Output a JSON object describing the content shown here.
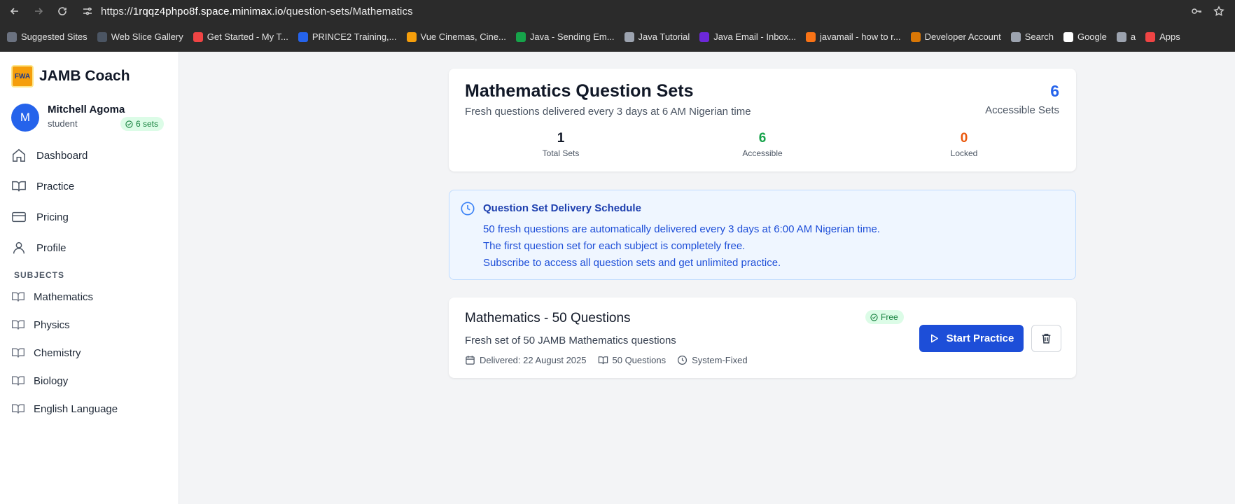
{
  "browser": {
    "url_prefix": "https://",
    "url_host": "1rqqz4phpo8f.space.minimax.io",
    "url_path": "/question-sets/Mathematics",
    "bookmarks": [
      {
        "label": "Suggested Sites",
        "icon": "suggested-icon",
        "color": "#6b7280"
      },
      {
        "label": "Web Slice Gallery",
        "icon": "web-slice-icon",
        "color": "#4b5563"
      },
      {
        "label": "Get Started - My T...",
        "icon": "location-pin-icon",
        "color": "#ef4444"
      },
      {
        "label": "PRINCE2 Training,...",
        "icon": "prince2-icon",
        "color": "#2563eb"
      },
      {
        "label": "Vue Cinemas, Cine...",
        "icon": "vue-icon",
        "color": "#f59e0b"
      },
      {
        "label": "Java - Sending Em...",
        "icon": "java-icon",
        "color": "#16a34a"
      },
      {
        "label": "Java Tutorial",
        "icon": "globe-icon",
        "color": "#9ca3af"
      },
      {
        "label": "Java Email - Inbox...",
        "icon": "yahoo-icon",
        "color": "#6d28d9"
      },
      {
        "label": "javamail - how to r...",
        "icon": "stackoverflow-icon",
        "color": "#f97316"
      },
      {
        "label": "Developer Account",
        "icon": "layers-icon",
        "color": "#d97706"
      },
      {
        "label": "Search",
        "icon": "search-icon",
        "color": "#9ca3af"
      },
      {
        "label": "Google",
        "icon": "google-icon",
        "color": "#ffffff"
      },
      {
        "label": "a",
        "icon": "globe-icon",
        "color": "#9ca3af"
      },
      {
        "label": "Apps",
        "icon": "apps-grid-icon",
        "color": "#ef4444"
      }
    ]
  },
  "sidebar": {
    "brand": "JAMB Coach",
    "logo_text": "FWA",
    "user": {
      "initial": "M",
      "name": "Mitchell Agoma",
      "role": "student",
      "sets": "6 sets"
    },
    "nav": [
      {
        "label": "Dashboard",
        "icon": "home-icon"
      },
      {
        "label": "Practice",
        "icon": "book-icon"
      },
      {
        "label": "Pricing",
        "icon": "credit-card-icon"
      },
      {
        "label": "Profile",
        "icon": "user-icon"
      }
    ],
    "subjects_heading": "SUBJECTS",
    "subjects": [
      "Mathematics",
      "Physics",
      "Chemistry",
      "Biology",
      "English Language"
    ]
  },
  "summary": {
    "title": "Mathematics Question Sets",
    "subtitle": "Fresh questions delivered every 3 days at 6 AM Nigerian time",
    "accessible_count": "6",
    "accessible_label": "Accessible Sets",
    "stats": [
      {
        "value": "1",
        "label": "Total Sets",
        "color": "#111827"
      },
      {
        "value": "6",
        "label": "Accessible",
        "color": "#16a34a"
      },
      {
        "value": "0",
        "label": "Locked",
        "color": "#ea580c"
      }
    ]
  },
  "schedule": {
    "title": "Question Set Delivery Schedule",
    "lines": [
      "50 fresh questions are automatically delivered every 3 days at 6:00 AM Nigerian time.",
      "The first question set for each subject is completely free.",
      "Subscribe to access all question sets and get unlimited practice."
    ]
  },
  "question_set": {
    "title": "Mathematics - 50 Questions",
    "badge": "Free",
    "description": "Fresh set of 50 JAMB Mathematics questions",
    "delivered": "Delivered: 22 August 2025",
    "questions": "50 Questions",
    "mode": "System-Fixed",
    "start_label": "Start Practice"
  }
}
